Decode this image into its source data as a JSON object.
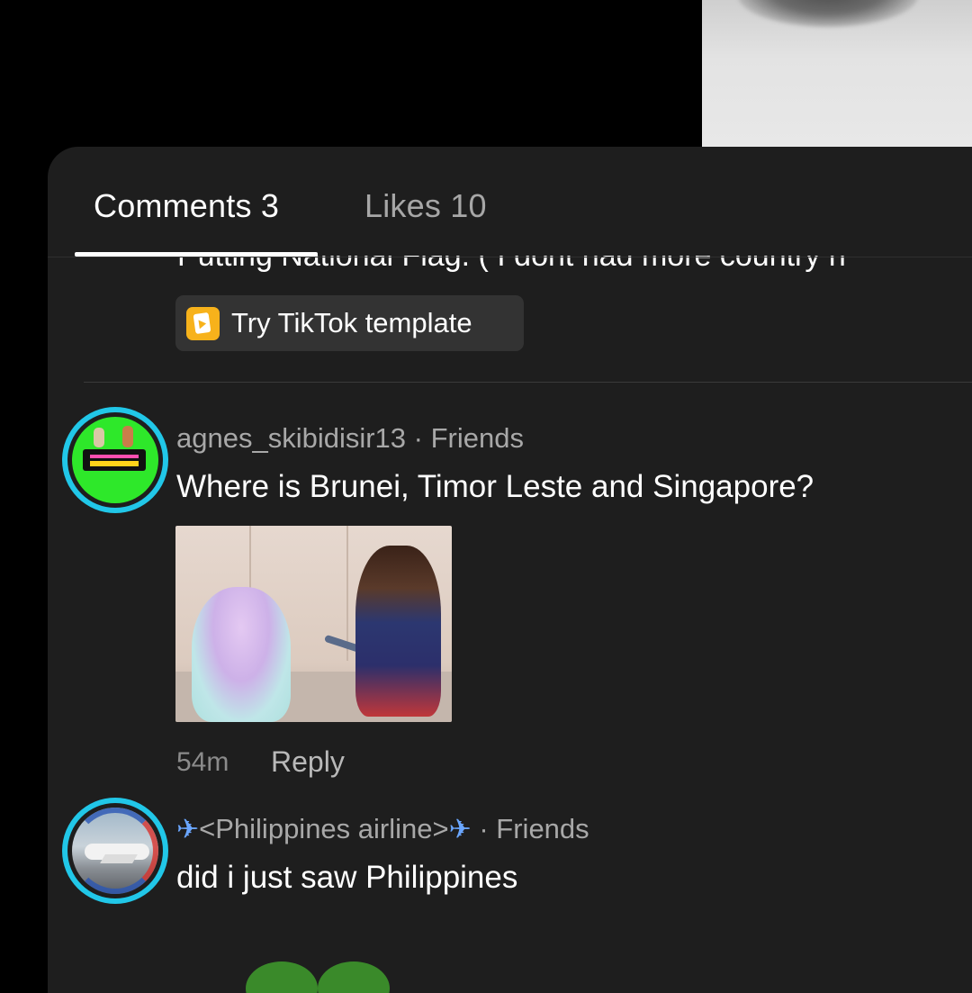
{
  "tabs": {
    "comments_label": "Comments 3",
    "likes_label": "Likes 10"
  },
  "caption_partial": "Putting National Flag. ( I dont had more country n",
  "template_button": {
    "label": "Try TikTok template",
    "icon": "template-icon"
  },
  "comments": [
    {
      "username": "agnes_skibidisir13",
      "relation": " · Friends",
      "text": "Where is Brunei, Timor Leste and Singapore?",
      "time": "54m",
      "reply_label": "Reply",
      "has_image": true
    },
    {
      "username": "<Philippines airline>",
      "plane_emoji": "✈",
      "relation": " · Friends",
      "text": "did i just saw Philippines"
    }
  ],
  "colors": {
    "panel_bg": "#1e1e1e",
    "avatar_ring": "#21c7e8",
    "template_icon": "#f7b21b"
  }
}
